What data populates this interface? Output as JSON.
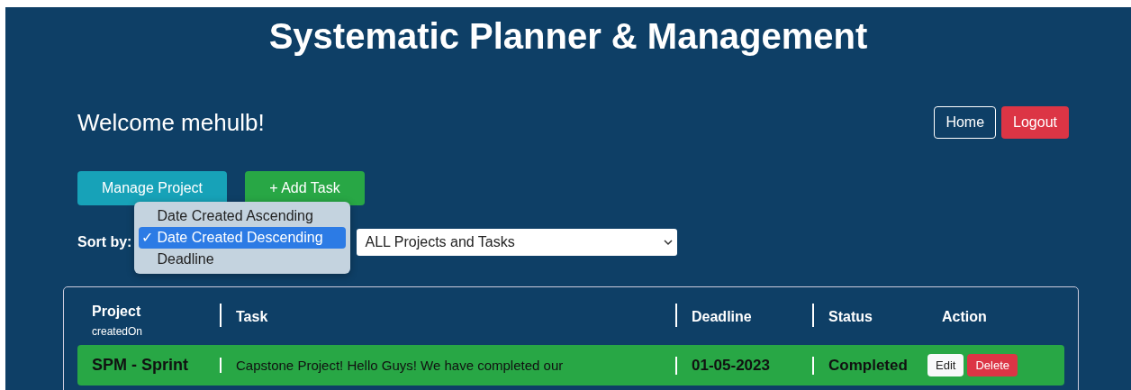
{
  "title": "Systematic Planner & Management",
  "welcome": "Welcome mehulb!",
  "nav_buttons": [
    {
      "label": "Home",
      "kind": "outline"
    },
    {
      "label": "Logout",
      "kind": "danger"
    }
  ],
  "action_buttons": [
    {
      "label": "Manage Project",
      "kind": "info"
    },
    {
      "label": "+ Add Task",
      "kind": "success"
    }
  ],
  "sort": {
    "label": "Sort by:",
    "options": [
      {
        "label": "Date Created Ascending",
        "selected": false
      },
      {
        "label": "Date Created Descending",
        "selected": true
      },
      {
        "label": "Deadline",
        "selected": false
      }
    ],
    "check": "✓"
  },
  "filter": {
    "value": "ALL Projects and Tasks"
  },
  "table": {
    "columns": [
      {
        "label": "Project",
        "sub": "createdOn"
      },
      {
        "label": "Task"
      },
      {
        "label": "Deadline"
      },
      {
        "label": "Status"
      },
      {
        "label": "Action"
      }
    ],
    "rows": [
      {
        "project": "SPM - Sprint",
        "task": "Capstone Project! Hello Guys! We have completed our",
        "deadline": "01-05-2023",
        "status": "Completed",
        "actions": [
          {
            "label": "Edit",
            "kind": "light"
          },
          {
            "label": "Delete",
            "kind": "danger"
          }
        ]
      }
    ]
  }
}
